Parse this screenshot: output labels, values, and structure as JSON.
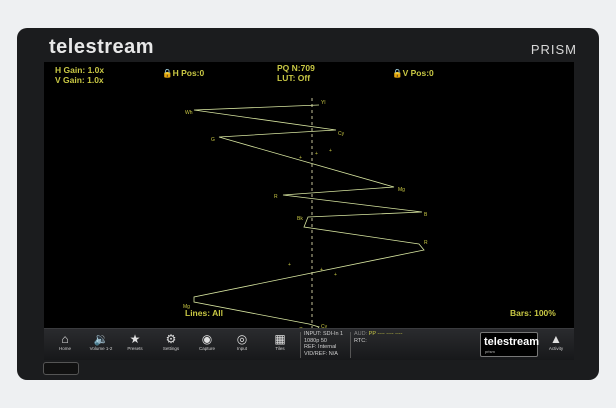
{
  "device": {
    "brand": "telestream",
    "product": "PRISM"
  },
  "status": {
    "h_gain": "H Gain: 1.0x",
    "v_gain": "V Gain: 1.0x",
    "h_pos": "H Pos:0",
    "v_pos": "V Pos:0",
    "pq": "PQ N:709",
    "lut": "LUT: Off",
    "lines": "Lines: All",
    "bars": "Bars: 100%"
  },
  "waveform": {
    "trace_color": "#d8e6a0",
    "center_line_color": "#f4f2c0",
    "point_labels": [
      "Wh",
      "Yl",
      "Cy",
      "G",
      "Mg",
      "R",
      "B",
      "Bk",
      "R",
      "Mg",
      "G",
      "Cy",
      "Wh",
      "Yl"
    ]
  },
  "toolbar": {
    "buttons": [
      {
        "label": "Home",
        "icon": "home-icon"
      },
      {
        "label": "Volume 1-2",
        "icon": "volume-icon"
      },
      {
        "label": "Presets",
        "icon": "star-icon"
      },
      {
        "label": "Settings",
        "icon": "gear-icon"
      },
      {
        "label": "Capture",
        "icon": "camera-icon"
      },
      {
        "label": "Input",
        "icon": "input-icon"
      },
      {
        "label": "Tiles",
        "icon": "tiles-icon"
      }
    ],
    "input_info": {
      "line1": "INPUT: SDI-In 1",
      "line2": "1080p 50",
      "line3": "REF: Internal",
      "line4": "VID/REF: N/A"
    },
    "aud_prefix": "AUD:",
    "aud_value": "PP ---- ---- ----",
    "rtc": "RTC:",
    "logo_text": "telestream",
    "logo_sub": "prism",
    "activity_label": "Activity",
    "accent": "#c9c844"
  }
}
